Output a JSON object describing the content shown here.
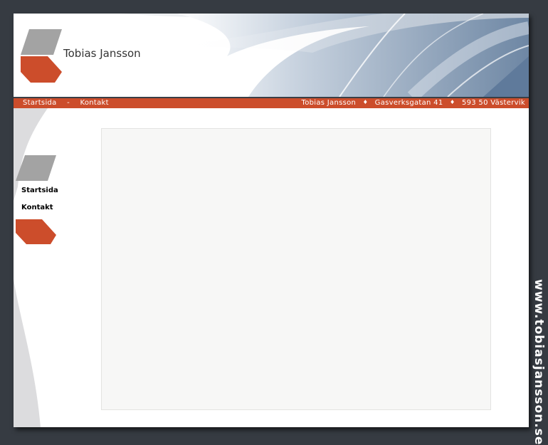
{
  "site": {
    "title": "Tobias Jansson",
    "url": "www.tobiasjansson.se"
  },
  "topnav": {
    "links": [
      "Startsida",
      "Kontakt"
    ],
    "separator": "-",
    "address": [
      "Tobias Jansson",
      "Gasverksgatan 41",
      "593 50 Västervik"
    ],
    "bullet": "♦"
  },
  "sidemenu": {
    "items": [
      "Startsida",
      "Kontakt"
    ]
  },
  "colors": {
    "accent": "#cc4d2b",
    "logo_gray": "#a3a3a3",
    "background": "#363b42",
    "panel": "#f7f7f6"
  },
  "icons": {
    "logo_top": "gray-parallelogram",
    "logo_bottom": "orange-parallelogram"
  }
}
